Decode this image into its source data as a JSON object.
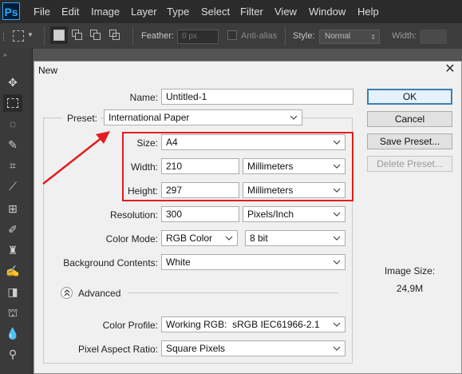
{
  "app": {
    "logo": "Ps",
    "menu": [
      "File",
      "Edit",
      "Image",
      "Layer",
      "Type",
      "Select",
      "Filter",
      "View",
      "Window",
      "Help"
    ]
  },
  "options_bar": {
    "feather_label": "Feather:",
    "feather_value": "0 px",
    "antialias_label": "Anti-alias",
    "style_label": "Style:",
    "style_value": "Normal",
    "width_label": "Width:"
  },
  "dialog": {
    "title": "New",
    "name_label": "Name:",
    "name_value": "Untitled-1",
    "preset_label": "Preset:",
    "preset_value": "International Paper",
    "size_label": "Size:",
    "size_value": "A4",
    "width_label": "Width:",
    "width_value": "210",
    "width_unit": "Millimeters",
    "height_label": "Height:",
    "height_value": "297",
    "height_unit": "Millimeters",
    "resolution_label": "Resolution:",
    "resolution_value": "300",
    "resolution_unit": "Pixels/Inch",
    "color_mode_label": "Color Mode:",
    "color_mode_value": "RGB Color",
    "bit_depth_value": "8 bit",
    "background_label": "Background Contents:",
    "background_value": "White",
    "advanced_label": "Advanced",
    "color_profile_label": "Color Profile:",
    "color_profile_value": "Working RGB:  sRGB IEC61966-2.1",
    "pixel_aspect_label": "Pixel Aspect Ratio:",
    "pixel_aspect_value": "Square Pixels",
    "ok_label": "OK",
    "cancel_label": "Cancel",
    "save_preset_label": "Save Preset...",
    "delete_preset_label": "Delete Preset...",
    "image_size_label": "Image Size:",
    "image_size_value": "24,9M"
  },
  "colors": {
    "annotation_red": "#e21d1d",
    "default_button_border": "#3c7fb1",
    "ps_blue": "#31a8ff"
  }
}
